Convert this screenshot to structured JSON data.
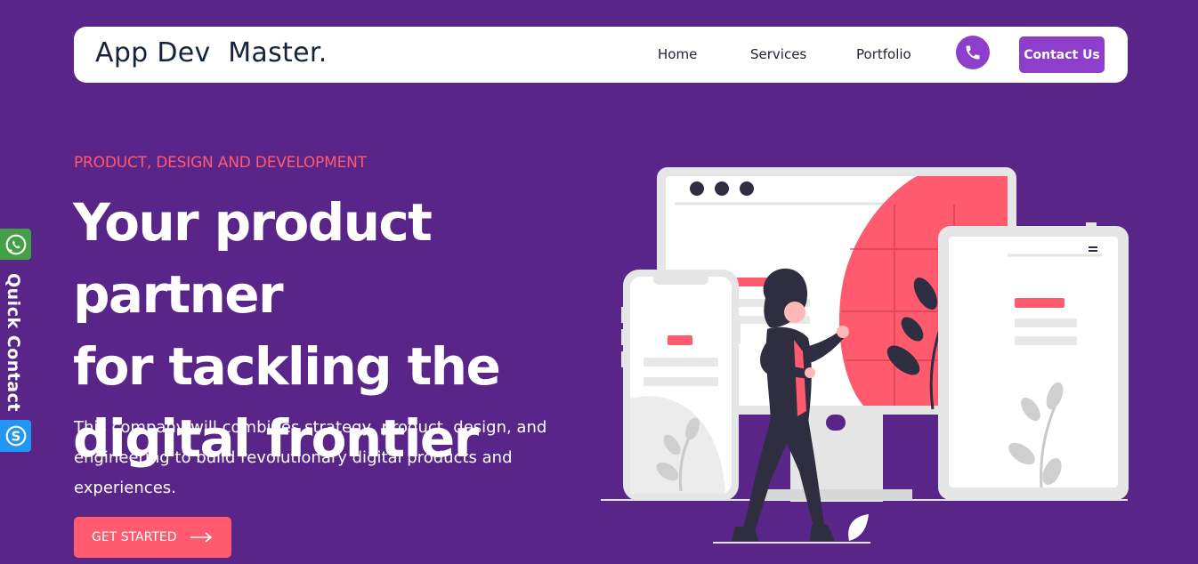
{
  "brand": {
    "name_part1": "App Dev",
    "name_part2": "Master."
  },
  "nav": {
    "links": [
      {
        "label": "Home"
      },
      {
        "label": "Services"
      },
      {
        "label": "Portfolio"
      }
    ],
    "phone_icon": "phone-icon",
    "contact_label": "Contact Us"
  },
  "quick_contact": {
    "label": "Quick Contact",
    "whatsapp_icon": "whatsapp-icon",
    "skype_icon": "skype-icon"
  },
  "hero": {
    "eyebrow": "PRODUCT, DESIGN AND DEVELOPMENT",
    "headline_line1": "Your product partner",
    "headline_line2": "for tackling the",
    "headline_line3": "digital frontier",
    "description": "This company will combines strategy, product, design, and engineering to build revolutionary digital products and experiences.",
    "cta_label": "GET STARTED",
    "cta_icon": "arrow-right-icon"
  },
  "colors": {
    "background": "#5a2589",
    "accent_pink": "#ff5a6e",
    "accent_purple": "#8d3fcc",
    "navy": "#15233b"
  }
}
